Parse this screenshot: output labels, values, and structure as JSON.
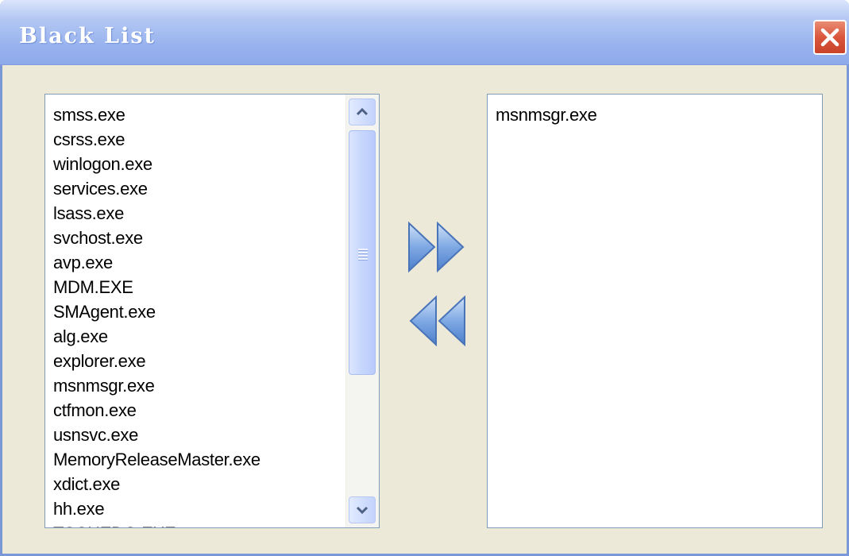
{
  "window": {
    "title": "Black List",
    "close_icon": "close-icon"
  },
  "available_list": {
    "items": [
      "smss.exe",
      "csrss.exe",
      "winlogon.exe",
      "services.exe",
      "lsass.exe",
      "svchost.exe",
      "avp.exe",
      "MDM.EXE",
      "SMAgent.exe",
      "alg.exe",
      "explorer.exe",
      "msnmsgr.exe",
      "ctfmon.exe",
      "usnsvc.exe",
      "MemoryReleaseMaster.exe",
      "xdict.exe",
      "hh.exe",
      "TSCHEDG.EXE"
    ],
    "scroll_up_icon": "chevron-up-icon",
    "scroll_down_icon": "chevron-down-icon"
  },
  "blacklist": {
    "items": [
      "msnmsgr.exe"
    ]
  },
  "actions": {
    "add_icon": "double-right-arrow-icon",
    "remove_icon": "double-left-arrow-icon"
  },
  "colors": {
    "titlebar": "#98b3ee",
    "window_bg": "#ece9d8",
    "close_button": "#d9573d",
    "arrow_blue": "#5d8fd6"
  }
}
